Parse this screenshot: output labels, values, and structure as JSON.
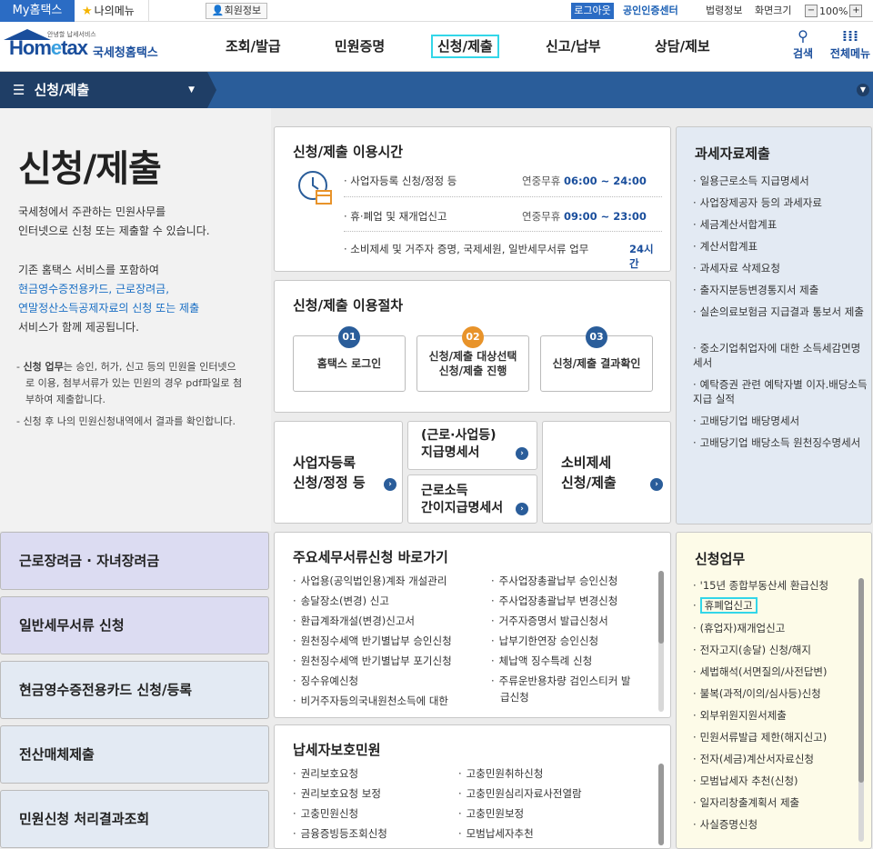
{
  "util": {
    "my_hometax": "My홈택스",
    "my_menu": "나의메뉴",
    "member_info": "회원정보",
    "logout": "로그아웃",
    "cert_center": "공인인증센터",
    "law_info": "법령정보",
    "screen_size": "화면크기",
    "zoom_minus": "−",
    "zoom_value": "100%",
    "zoom_plus": "+"
  },
  "header": {
    "logo_small": "안녕할 납세서비스",
    "logo_main_1": "Hom",
    "logo_main_e": "e",
    "logo_main_2": "tax",
    "logo_kr": "국세청홈택스",
    "nav": [
      "조회/발급",
      "민원증명",
      "신청/제출",
      "신고/납부",
      "상담/제보"
    ],
    "search_label": "검색",
    "all_menu_label": "전체메뉴"
  },
  "locbar": {
    "current": "신청/제출"
  },
  "intro": {
    "title": "신청/제출",
    "p1_line1": "국세청에서 주관하는 민원사무를",
    "p1_line2": "인터넷으로 신청 또는 제출할 수 있습니다.",
    "p2_line1": "기존 홈택스 서비스를 포함하여",
    "p2_blue1": "현금영수증전용카드, 근로장려금,",
    "p2_blue2": "연말정산소득공제자료의 신청 또는 제출",
    "p2_line3": "서비스가 함께 제공됩니다.",
    "note1_bold": "신청 업무",
    "note1_l1": "는 승인, 허가, 신고 등의 민원을 인터넷으",
    "note1_l2": "로 이용, 첨부서류가 있는 민원의 경우 pdf파일로 첨",
    "note1_l3": "부하여 제출합니다.",
    "note2": "신청 후 나의 민원신청내역에서 결과를 확인합니다."
  },
  "usage_time": {
    "title": "신청/제출 이용시간",
    "rows": [
      {
        "label": "· 사업자등록 신청/정정 등",
        "val_pre": "연중무휴 ",
        "val": "06:00 ~ 24:00"
      },
      {
        "label": "· 휴·폐업 및 재개업신고",
        "val_pre": "연중무휴 ",
        "val": "09:00 ~ 23:00"
      },
      {
        "label": "· 소비제세 및 거주자 증명, 국제세원, 일반세무서류 업무",
        "val": "24시간"
      }
    ]
  },
  "procedure": {
    "title": "신청/제출 이용절차",
    "steps": [
      {
        "num": "01",
        "line1": "홈택스 로그인",
        "line2": ""
      },
      {
        "num": "02",
        "line1": "신청/제출 대상선택",
        "line2": "신청/제출 진행"
      },
      {
        "num": "03",
        "line1": "신청/제출 결과확인",
        "line2": ""
      }
    ]
  },
  "quick": {
    "biz_line1": "사업자등록",
    "biz_line2": "신청/정정 등",
    "wage_line1": "(근로·사업등)",
    "wage_line2": "지급명세서",
    "simple_line1": "근로소득",
    "simple_line2": "간이지급명세서",
    "consume_line1": "소비제세",
    "consume_line2": "신청/제출"
  },
  "side_menu": [
    "근로장려금 · 자녀장려금",
    "일반세무서류 신청",
    "현금영수증전용카드 신청/등록",
    "전산매체제출",
    "민원신청 처리결과조회"
  ],
  "main_docs": {
    "title": "주요세무서류신청 바로가기",
    "left": [
      "사업용(공익법인용)계좌 개설관리",
      "송달장소(변경) 신고",
      "환급계좌개설(변경)신고서",
      "원천징수세액 반기별납부 승인신청",
      "원천징수세액 반기별납부 포기신청",
      "징수유예신청",
      "비거주자등의국내원천소득에 대한"
    ],
    "right": [
      "주사업장총괄납부 승인신청",
      "주사업장총괄납부 변경신청",
      "거주자증명서 발급신청서",
      "납부기한연장 승인신청",
      "체납액 징수특례 신청",
      "주류운반용차량 검인스티커 발",
      "급신청"
    ]
  },
  "protect": {
    "title": "납세자보호민원",
    "left": [
      "권리보호요청",
      "권리보호요청 보정",
      "고충민원신청",
      "금융증빙등조회신청"
    ],
    "right": [
      "고충민원취하신청",
      "고충민원심리자료사전열람",
      "고충민원보정",
      "모범납세자추천"
    ]
  },
  "tax_data": {
    "title": "과세자료제출",
    "items": [
      "일용근로소득 지급명세서",
      "사업장제공자 등의 과세자료",
      "세금계산서합계표",
      "계산서합계표",
      "과세자료 삭제요청",
      "출자지분등변경통지서 제출",
      "실손의료보험금 지급결과 통보서 제출",
      "중소기업취업자에 대한 소득세감면명세서",
      "예탁증권 관련 예탁자별 이자.배당소득 지급 실적",
      "고배당기업 배당명세서",
      "고배당기업 배당소득 원천징수명세서"
    ]
  },
  "apply_work": {
    "title": "신청업무",
    "items": [
      "'15년 종합부동산세 환급신청",
      "휴폐업신고",
      "(휴업자)재개업신고",
      "전자고지(송달) 신청/해지",
      "세법해석(서면질의/사전답변)",
      "불복(과적/이의/심사등)신청",
      "외부위원지원서제출",
      "민원서류발급 제한(해지신고)",
      "전자(세금)계산서자료신청",
      "모범납세자 추천(신청)",
      "일자리창출계획서 제출",
      "사실증명신청"
    ]
  }
}
